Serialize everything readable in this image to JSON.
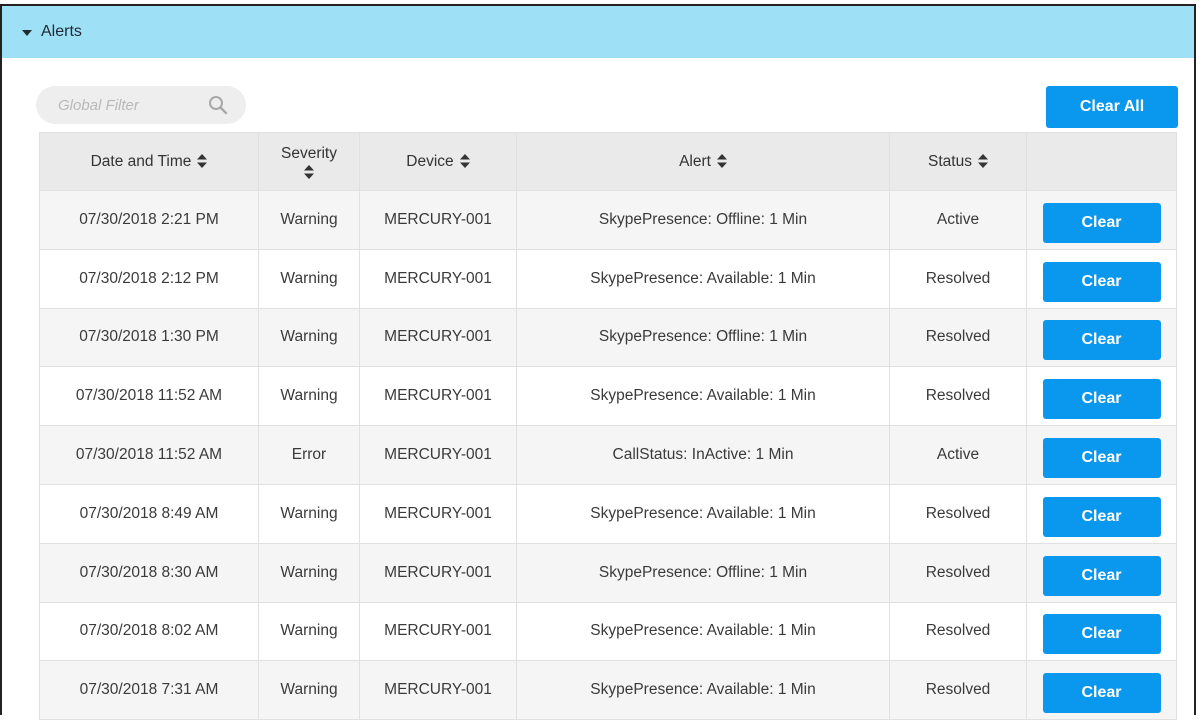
{
  "panel": {
    "title": "Alerts"
  },
  "filter": {
    "placeholder": "Global Filter"
  },
  "toolbar": {
    "clear_all_label": "Clear All"
  },
  "table": {
    "headers": {
      "date": "Date and Time",
      "severity": "Severity",
      "device": "Device",
      "alert": "Alert",
      "status": "Status"
    },
    "rows": [
      {
        "date": "07/30/2018 2:21 PM",
        "severity": "Warning",
        "device": "MERCURY-001",
        "alert": "SkypePresence: Offline: 1 Min",
        "status": "Active",
        "action": "Clear"
      },
      {
        "date": "07/30/2018 2:12 PM",
        "severity": "Warning",
        "device": "MERCURY-001",
        "alert": "SkypePresence: Available: 1 Min",
        "status": "Resolved",
        "action": "Clear"
      },
      {
        "date": "07/30/2018 1:30 PM",
        "severity": "Warning",
        "device": "MERCURY-001",
        "alert": "SkypePresence: Offline: 1 Min",
        "status": "Resolved",
        "action": "Clear"
      },
      {
        "date": "07/30/2018 11:52 AM",
        "severity": "Warning",
        "device": "MERCURY-001",
        "alert": "SkypePresence: Available: 1 Min",
        "status": "Resolved",
        "action": "Clear"
      },
      {
        "date": "07/30/2018 11:52 AM",
        "severity": "Error",
        "device": "MERCURY-001",
        "alert": "CallStatus: InActive: 1 Min",
        "status": "Active",
        "action": "Clear"
      },
      {
        "date": "07/30/2018 8:49 AM",
        "severity": "Warning",
        "device": "MERCURY-001",
        "alert": "SkypePresence: Available: 1 Min",
        "status": "Resolved",
        "action": "Clear"
      },
      {
        "date": "07/30/2018 8:30 AM",
        "severity": "Warning",
        "device": "MERCURY-001",
        "alert": "SkypePresence: Offline: 1 Min",
        "status": "Resolved",
        "action": "Clear"
      },
      {
        "date": "07/30/2018 8:02 AM",
        "severity": "Warning",
        "device": "MERCURY-001",
        "alert": "SkypePresence: Available: 1 Min",
        "status": "Resolved",
        "action": "Clear"
      },
      {
        "date": "07/30/2018 7:31 AM",
        "severity": "Warning",
        "device": "MERCURY-001",
        "alert": "SkypePresence: Available: 1 Min",
        "status": "Resolved",
        "action": "Clear"
      }
    ]
  },
  "icons": {
    "panel_toggle": "caret-down-icon",
    "filter": "search-icon",
    "sort": "sort-icon"
  },
  "colors": {
    "header_band": "#9ee0f5",
    "button": "#0a97ee",
    "table_header": "#eaeaea",
    "row_stripe": "#f5f5f5"
  }
}
